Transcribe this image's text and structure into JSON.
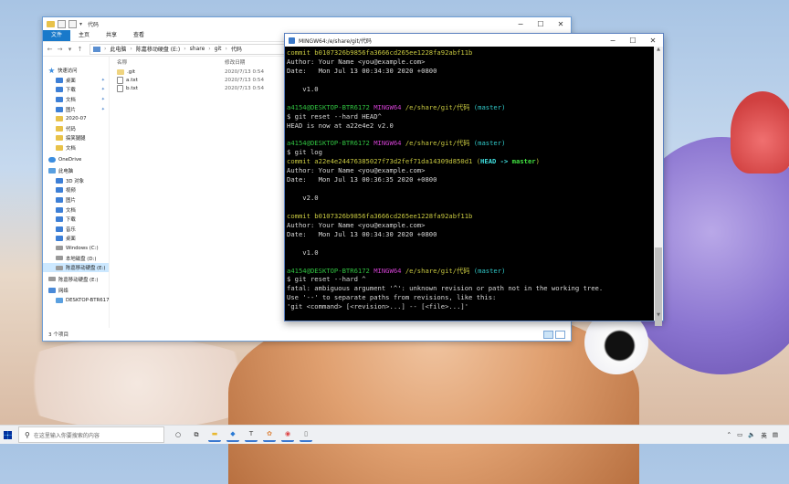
{
  "explorer": {
    "title": "代码",
    "ribbon_tabs": [
      "文件",
      "主页",
      "共享",
      "查看"
    ],
    "breadcrumbs": [
      "此电脑",
      "陈嘉移动硬盘 (E:)",
      "share",
      "git",
      "代码"
    ],
    "nav": [
      {
        "label": "快速访问",
        "icon": "star-icon",
        "level": 0
      },
      {
        "label": "桌面",
        "icon": "desktop-icon",
        "level": 1,
        "pinned": true
      },
      {
        "label": "下载",
        "icon": "download-icon",
        "level": 1,
        "pinned": true
      },
      {
        "label": "文档",
        "icon": "document-icon",
        "level": 1,
        "pinned": true
      },
      {
        "label": "图片",
        "icon": "picture-icon",
        "level": 1,
        "pinned": true
      },
      {
        "label": "2020-07",
        "icon": "folder-icon",
        "level": 1
      },
      {
        "label": "代码",
        "icon": "folder-icon",
        "level": 1
      },
      {
        "label": "搞笑腿腿",
        "icon": "folder-icon",
        "level": 1
      },
      {
        "label": "文档",
        "icon": "folder-icon",
        "level": 1
      },
      {
        "label": "OneDrive",
        "icon": "cloud-icon",
        "level": 0
      },
      {
        "label": "此电脑",
        "icon": "computer-icon",
        "level": 0
      },
      {
        "label": "3D 对象",
        "icon": "cube-icon",
        "level": 1
      },
      {
        "label": "视频",
        "icon": "video-icon",
        "level": 1
      },
      {
        "label": "图片",
        "icon": "picture-icon",
        "level": 1
      },
      {
        "label": "文档",
        "icon": "document-icon",
        "level": 1
      },
      {
        "label": "下载",
        "icon": "download-icon",
        "level": 1
      },
      {
        "label": "音乐",
        "icon": "music-icon",
        "level": 1
      },
      {
        "label": "桌面",
        "icon": "desktop-icon",
        "level": 1
      },
      {
        "label": "Windows (C:)",
        "icon": "drive-icon",
        "level": 1
      },
      {
        "label": "本地磁盘 (D:)",
        "icon": "drive-icon",
        "level": 1
      },
      {
        "label": "陈嘉移动硬盘 (E:)",
        "icon": "drive-icon",
        "level": 1,
        "selected": true
      },
      {
        "label": "陈嘉移动硬盘 (E:)",
        "icon": "drive-icon",
        "level": 0
      },
      {
        "label": "网络",
        "icon": "network-icon",
        "level": 0
      },
      {
        "label": "DESKTOP-BTR617",
        "icon": "computer-icon",
        "level": 1
      }
    ],
    "columns": {
      "name": "名称",
      "date": "修改日期"
    },
    "files": [
      {
        "name": ".git",
        "date": "2020/7/13 0:54",
        "type": "文",
        "icon": "folder-icon"
      },
      {
        "name": "a.txt",
        "date": "2020/7/13 0:54",
        "type": "文",
        "icon": "text-file-icon"
      },
      {
        "name": "b.txt",
        "date": "2020/7/13 0:54",
        "type": "文",
        "icon": "text-file-icon"
      }
    ],
    "status": "3 个项目"
  },
  "terminal": {
    "title": "MINGW64:/e/share/git/代码",
    "lines": [
      [
        {
          "t": "commit b0107326b9856fa3666cd265ee1228fa92abf11b",
          "c": "yellow"
        }
      ],
      [
        {
          "t": "Author: Your Name <you@example.com>",
          "c": "white"
        }
      ],
      [
        {
          "t": "Date:   Mon Jul 13 00:34:30 2020 +0800",
          "c": "white"
        }
      ],
      [
        {
          "t": "",
          "c": "white"
        }
      ],
      [
        {
          "t": "    v1.0",
          "c": "white"
        }
      ],
      [
        {
          "t": "",
          "c": "white"
        }
      ],
      [
        {
          "t": "a4154@DESKTOP-BTR6172 ",
          "c": "green"
        },
        {
          "t": "MINGW64 ",
          "c": "magenta"
        },
        {
          "t": "/e/share/git/代码 ",
          "c": "yellow"
        },
        {
          "t": "(master)",
          "c": "cyan"
        }
      ],
      [
        {
          "t": "$ git reset --hard HEAD^",
          "c": "white"
        }
      ],
      [
        {
          "t": "HEAD is now at a22e4e2 v2.0",
          "c": "white"
        }
      ],
      [
        {
          "t": "",
          "c": "white"
        }
      ],
      [
        {
          "t": "a4154@DESKTOP-BTR6172 ",
          "c": "green"
        },
        {
          "t": "MINGW64 ",
          "c": "magenta"
        },
        {
          "t": "/e/share/git/代码 ",
          "c": "yellow"
        },
        {
          "t": "(master)",
          "c": "cyan"
        }
      ],
      [
        {
          "t": "$ git log",
          "c": "white"
        }
      ],
      [
        {
          "t": "commit a22e4e24476385027f73d2fef71da14309d850d1 ",
          "c": "yellow"
        },
        {
          "t": "(",
          "c": "yellow"
        },
        {
          "t": "HEAD -> ",
          "c": "bcyan"
        },
        {
          "t": "master",
          "c": "bgreen"
        },
        {
          "t": ")",
          "c": "yellow"
        }
      ],
      [
        {
          "t": "Author: Your Name <you@example.com>",
          "c": "white"
        }
      ],
      [
        {
          "t": "Date:   Mon Jul 13 00:36:35 2020 +0800",
          "c": "white"
        }
      ],
      [
        {
          "t": "",
          "c": "white"
        }
      ],
      [
        {
          "t": "    v2.0",
          "c": "white"
        }
      ],
      [
        {
          "t": "",
          "c": "white"
        }
      ],
      [
        {
          "t": "commit b0107326b9856fa3666cd265ee1228fa92abf11b",
          "c": "yellow"
        }
      ],
      [
        {
          "t": "Author: Your Name <you@example.com>",
          "c": "white"
        }
      ],
      [
        {
          "t": "Date:   Mon Jul 13 00:34:30 2020 +0800",
          "c": "white"
        }
      ],
      [
        {
          "t": "",
          "c": "white"
        }
      ],
      [
        {
          "t": "    v1.0",
          "c": "white"
        }
      ],
      [
        {
          "t": "",
          "c": "white"
        }
      ],
      [
        {
          "t": "a4154@DESKTOP-BTR6172 ",
          "c": "green"
        },
        {
          "t": "MINGW64 ",
          "c": "magenta"
        },
        {
          "t": "/e/share/git/代码 ",
          "c": "yellow"
        },
        {
          "t": "(master)",
          "c": "cyan"
        }
      ],
      [
        {
          "t": "$ git reset --hard ^",
          "c": "white"
        }
      ],
      [
        {
          "t": "fatal: ambiguous argument '^': unknown revision or path not in the working tree.",
          "c": "white"
        }
      ],
      [
        {
          "t": "Use '--' to separate paths from revisions, like this:",
          "c": "white"
        }
      ],
      [
        {
          "t": "'git <command> [<revision>...] -- [<file>...]'",
          "c": "white"
        }
      ]
    ]
  },
  "taskbar": {
    "search_placeholder": "在这里输入你要搜索的内容",
    "apps": [
      {
        "name": "cortana-icon",
        "glyph": "○"
      },
      {
        "name": "task-view-icon",
        "glyph": "⧉"
      },
      {
        "name": "file-explorer-icon",
        "glyph": "▬",
        "color": "#e8b830"
      },
      {
        "name": "vscode-icon",
        "glyph": "◆",
        "color": "#2a7ad4"
      },
      {
        "name": "typora-icon",
        "glyph": "T",
        "color": "#444"
      },
      {
        "name": "paint-icon",
        "glyph": "✿",
        "color": "#d84"
      },
      {
        "name": "chrome-icon",
        "glyph": "◉",
        "color": "#d44"
      },
      {
        "name": "notepad-icon",
        "glyph": "▯",
        "color": "#666"
      }
    ],
    "tray_lang": "英"
  },
  "colors": {
    "accent": "#1979ca",
    "terminal_bg": "#000000",
    "selection": "#cce8ff"
  }
}
